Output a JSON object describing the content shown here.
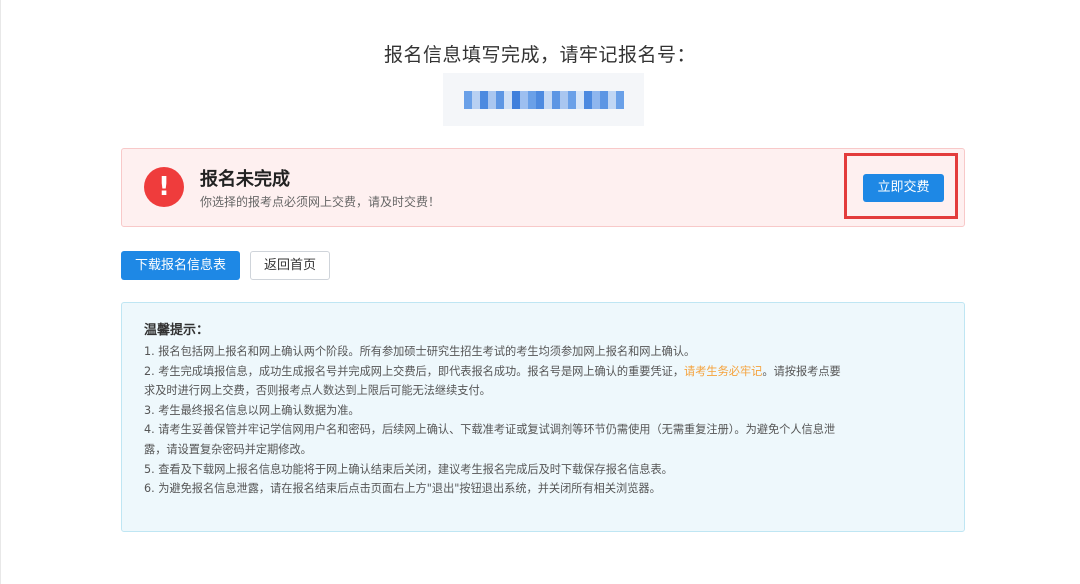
{
  "page": {
    "title": "报名信息填写完成，请牢记报名号："
  },
  "registration": {
    "number_masked": true,
    "pixel_colors": [
      "#6aa0e8",
      "#b8d0f2",
      "#4d8ae0",
      "#a9c6f0",
      "#5d96e4",
      "#d0e0f6",
      "#3f7fdc",
      "#9dbff0",
      "#6aa0e8",
      "#4d8ae0",
      "#c6d9f4",
      "#5d96e4",
      "#a9c6f0",
      "#6aa0e8",
      "#d8e6f8",
      "#4d8ae0",
      "#8fb6ee",
      "#5d96e4",
      "#c0d6f4",
      "#6aa0e8"
    ]
  },
  "alert": {
    "title": "报名未完成",
    "message": "你选择的报考点必须网上交费，请及时交费！",
    "icon": "exclamation-icon",
    "pay_button_label": "立即交费"
  },
  "actions": {
    "download_label": "下载报名信息表",
    "home_label": "返回首页"
  },
  "tips": {
    "title": "温馨提示：",
    "line1": "1. 报名包括网上报名和网上确认两个阶段。所有参加硕士研究生招生考试的考生均须参加网上报名和网上确认。",
    "line2a": "2. 考生完成填报信息，成功生成报名号并完成网上交费后，即代表报名成功。报名号是网上确认的重要凭证，",
    "line2_highlight": "请考生务必牢记",
    "line2b": "。请按报考点要",
    "line2c": "求及时进行网上交费，否则报考点人数达到上限后可能无法继续支付。",
    "line3": "3. 考生最终报名信息以网上确认数据为准。",
    "line4a": "4. 请考生妥善保管并牢记学信网用户名和密码，后续网上确认、下载准考证或复试调剂等环节仍需使用（无需重复注册）。为避免个人信息泄",
    "line4b": "露，请设置复杂密码并定期修改。",
    "line5": "5. 查看及下载网上报名信息功能将于网上确认结束后关闭，建议考生报名完成后及时下载保存报名信息表。",
    "line6": "6. 为避免报名信息泄露，请在报名结束后点击页面右上方\"退出\"按钮退出系统，并关闭所有相关浏览器。"
  },
  "colors": {
    "primary": "#1e88e5",
    "danger": "#ef3c3c",
    "warning_text": "#f5a23b",
    "highlight_border": "#e33c3c"
  }
}
